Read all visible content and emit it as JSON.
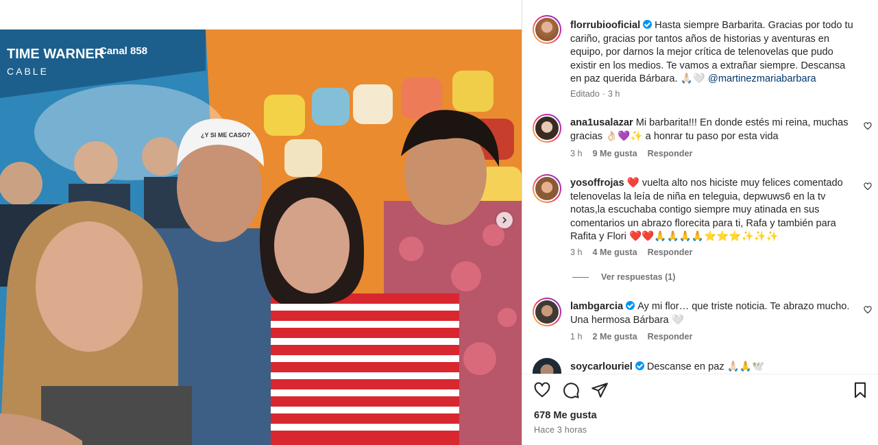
{
  "photo": {
    "sign_brand": "TIME WARNER",
    "sign_sub": "CABLE",
    "sign_channel": "Canal 858",
    "cap_text": "¿Y SI ME CASO?"
  },
  "post": {
    "username": "florrubiooficial",
    "caption": "Hasta siempre Barbarita. Gracias por todo tu cariño, gracias por tantos años de historias y aventuras en equipo, por darnos la mejor crítica de telenovelas que pudo existir en los medios. Te vamos a extrañar siempre. Descansa en paz querida Bárbara. 🙏🏻🤍",
    "mention": "@martinezmariabarbara",
    "edited_label": "Editado",
    "time": "3 h"
  },
  "comments": [
    {
      "username": "ana1usalazar",
      "text": "Mi barbarita!!! En donde estés mi reina, muchas gracias 👌🏻💜✨ a honrar tu paso por esta vida",
      "time": "3 h",
      "likes": "9 Me gusta",
      "reply": "Responder"
    },
    {
      "username": "yosoffrojas",
      "text": "❤️ vuelta alto nos hiciste muy felices comentado telenovelas la leía de niña en teleguia, depwuws6 en la tv notas,la escuchaba contigo siempre muy atinada en sus comentarios un abrazo florecita para ti, Rafa y también para Rafita y Flori ❤️❤️🙏🙏🙏🙏⭐⭐⭐✨✨✨",
      "time": "3 h",
      "likes": "4 Me gusta",
      "reply": "Responder"
    },
    {
      "username": "lambgarcia",
      "text": "Ay mi flor… que triste noticia. Te abrazo mucho. Una hermosa Bárbara 🤍",
      "time": "1 h",
      "likes": "2 Me gusta",
      "reply": "Responder"
    },
    {
      "username": "soycarlouriel",
      "text": "Descanse en paz 🙏🏻🙏🕊️"
    }
  ],
  "view_replies": "Ver respuestas (1)",
  "footer": {
    "likes": "678 Me gusta",
    "ago": "Hace 3 horas"
  },
  "icons": {
    "like": "heart-icon",
    "comment": "comment-icon",
    "share": "paper-plane-icon",
    "save": "bookmark-icon",
    "next": "chevron-right-icon"
  }
}
